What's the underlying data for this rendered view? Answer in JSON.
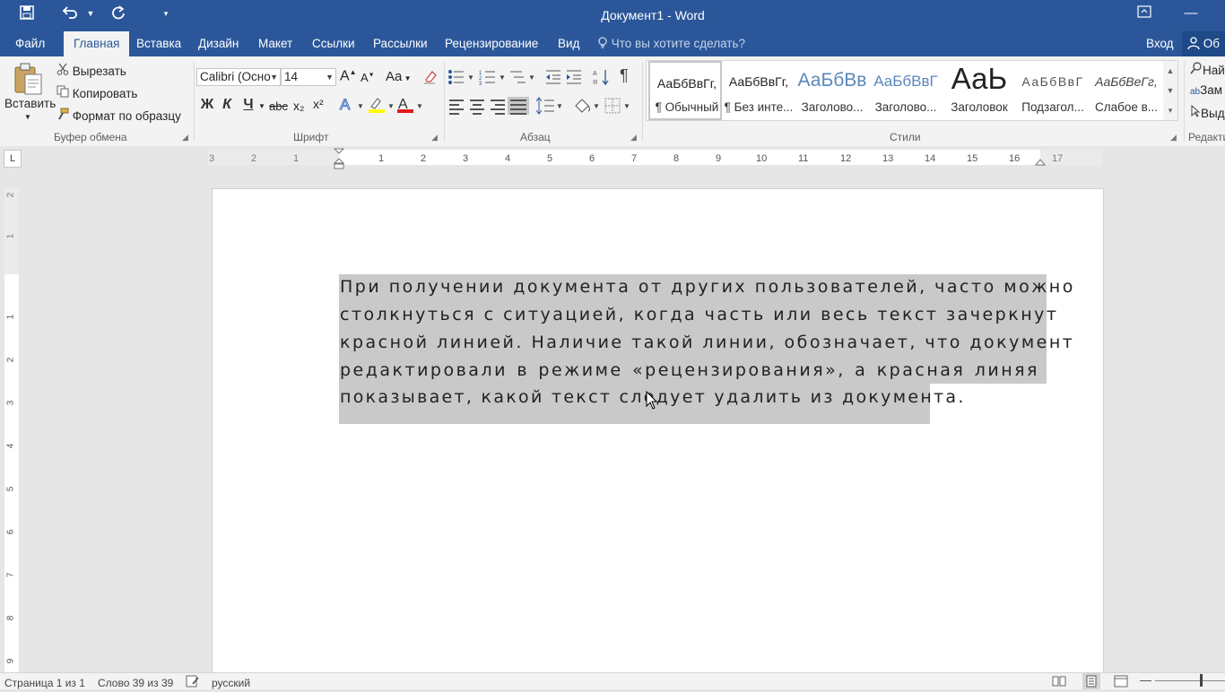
{
  "window": {
    "title": "Документ1 - Word",
    "minimize_glyph": "—",
    "restore_glyph": "⧉"
  },
  "quick_access": {
    "save_icon": "save-icon",
    "undo_icon": "undo-icon",
    "redo_icon": "redo-icon",
    "customize_icon": "customize-icon"
  },
  "tabs": [
    {
      "label": "Файл"
    },
    {
      "label": "Главная"
    },
    {
      "label": "Вставка"
    },
    {
      "label": "Дизайн"
    },
    {
      "label": "Макет"
    },
    {
      "label": "Ссылки"
    },
    {
      "label": "Рассылки"
    },
    {
      "label": "Рецензирование"
    },
    {
      "label": "Вид"
    }
  ],
  "tell_me": {
    "placeholder": "Что вы хотите сделать?"
  },
  "account": {
    "sign_in": "Вход",
    "share": "Об"
  },
  "clipboard": {
    "paste": "Вставить",
    "cut": "Вырезать",
    "copy": "Копировать",
    "format_painter": "Формат по образцу",
    "group_label": "Буфер обмена"
  },
  "font": {
    "name": "Calibri (Осно",
    "size": "14",
    "grow": "A",
    "shrink": "A",
    "change_case": "Aa",
    "bold": "Ж",
    "italic": "К",
    "underline": "Ч",
    "strikethrough": "abc",
    "subscript": "x₂",
    "superscript": "x²",
    "group_label": "Шрифт",
    "highlight_color": "#ffff00",
    "font_color": "#e21b1b"
  },
  "paragraph": {
    "group_label": "Абзац",
    "show_marks": "¶"
  },
  "styles": {
    "group_label": "Стили",
    "items": [
      {
        "sample": "АаБбВвГг,",
        "name": "¶ Обычный"
      },
      {
        "sample": "АаБбВвГг,",
        "name": "¶ Без инте..."
      },
      {
        "sample": "АаБбВв",
        "name": "Заголово..."
      },
      {
        "sample": "АаБбВвГ",
        "name": "Заголово..."
      },
      {
        "sample": "АаЬ",
        "name": "Заголовок"
      },
      {
        "sample": "АаБбВвГ",
        "name": "Подзагол..."
      },
      {
        "sample": "АаБбВеГг,",
        "name": "Слабое в..."
      }
    ]
  },
  "editing": {
    "group_label": "Редакти",
    "find": "Най",
    "replace": "Зам",
    "select": "Выд"
  },
  "ruler": {
    "corner": "L",
    "h_ticks": [
      "3",
      "2",
      "1",
      "1",
      "2",
      "3",
      "4",
      "5",
      "6",
      "7",
      "8",
      "9",
      "10",
      "11",
      "12",
      "13",
      "14",
      "15",
      "16",
      "17"
    ],
    "v_ticks": [
      "2",
      "1",
      "1",
      "2",
      "3",
      "4",
      "5",
      "6",
      "7",
      "8",
      "9"
    ]
  },
  "document": {
    "lines": [
      "При получении документа от других пользователей, часто можно",
      "столкнуться с ситуацией, когда часть или весь текст зачеркнут",
      "красной линией. Наличие такой линии, обозначает, что документ",
      "редактировали в режиме «рецензирования», а красная линяя",
      "показывает, какой текст следует удалить из документа."
    ]
  },
  "status": {
    "page": "Страница 1 из 1",
    "words": "Слово 39 из 39",
    "language": "русский"
  }
}
